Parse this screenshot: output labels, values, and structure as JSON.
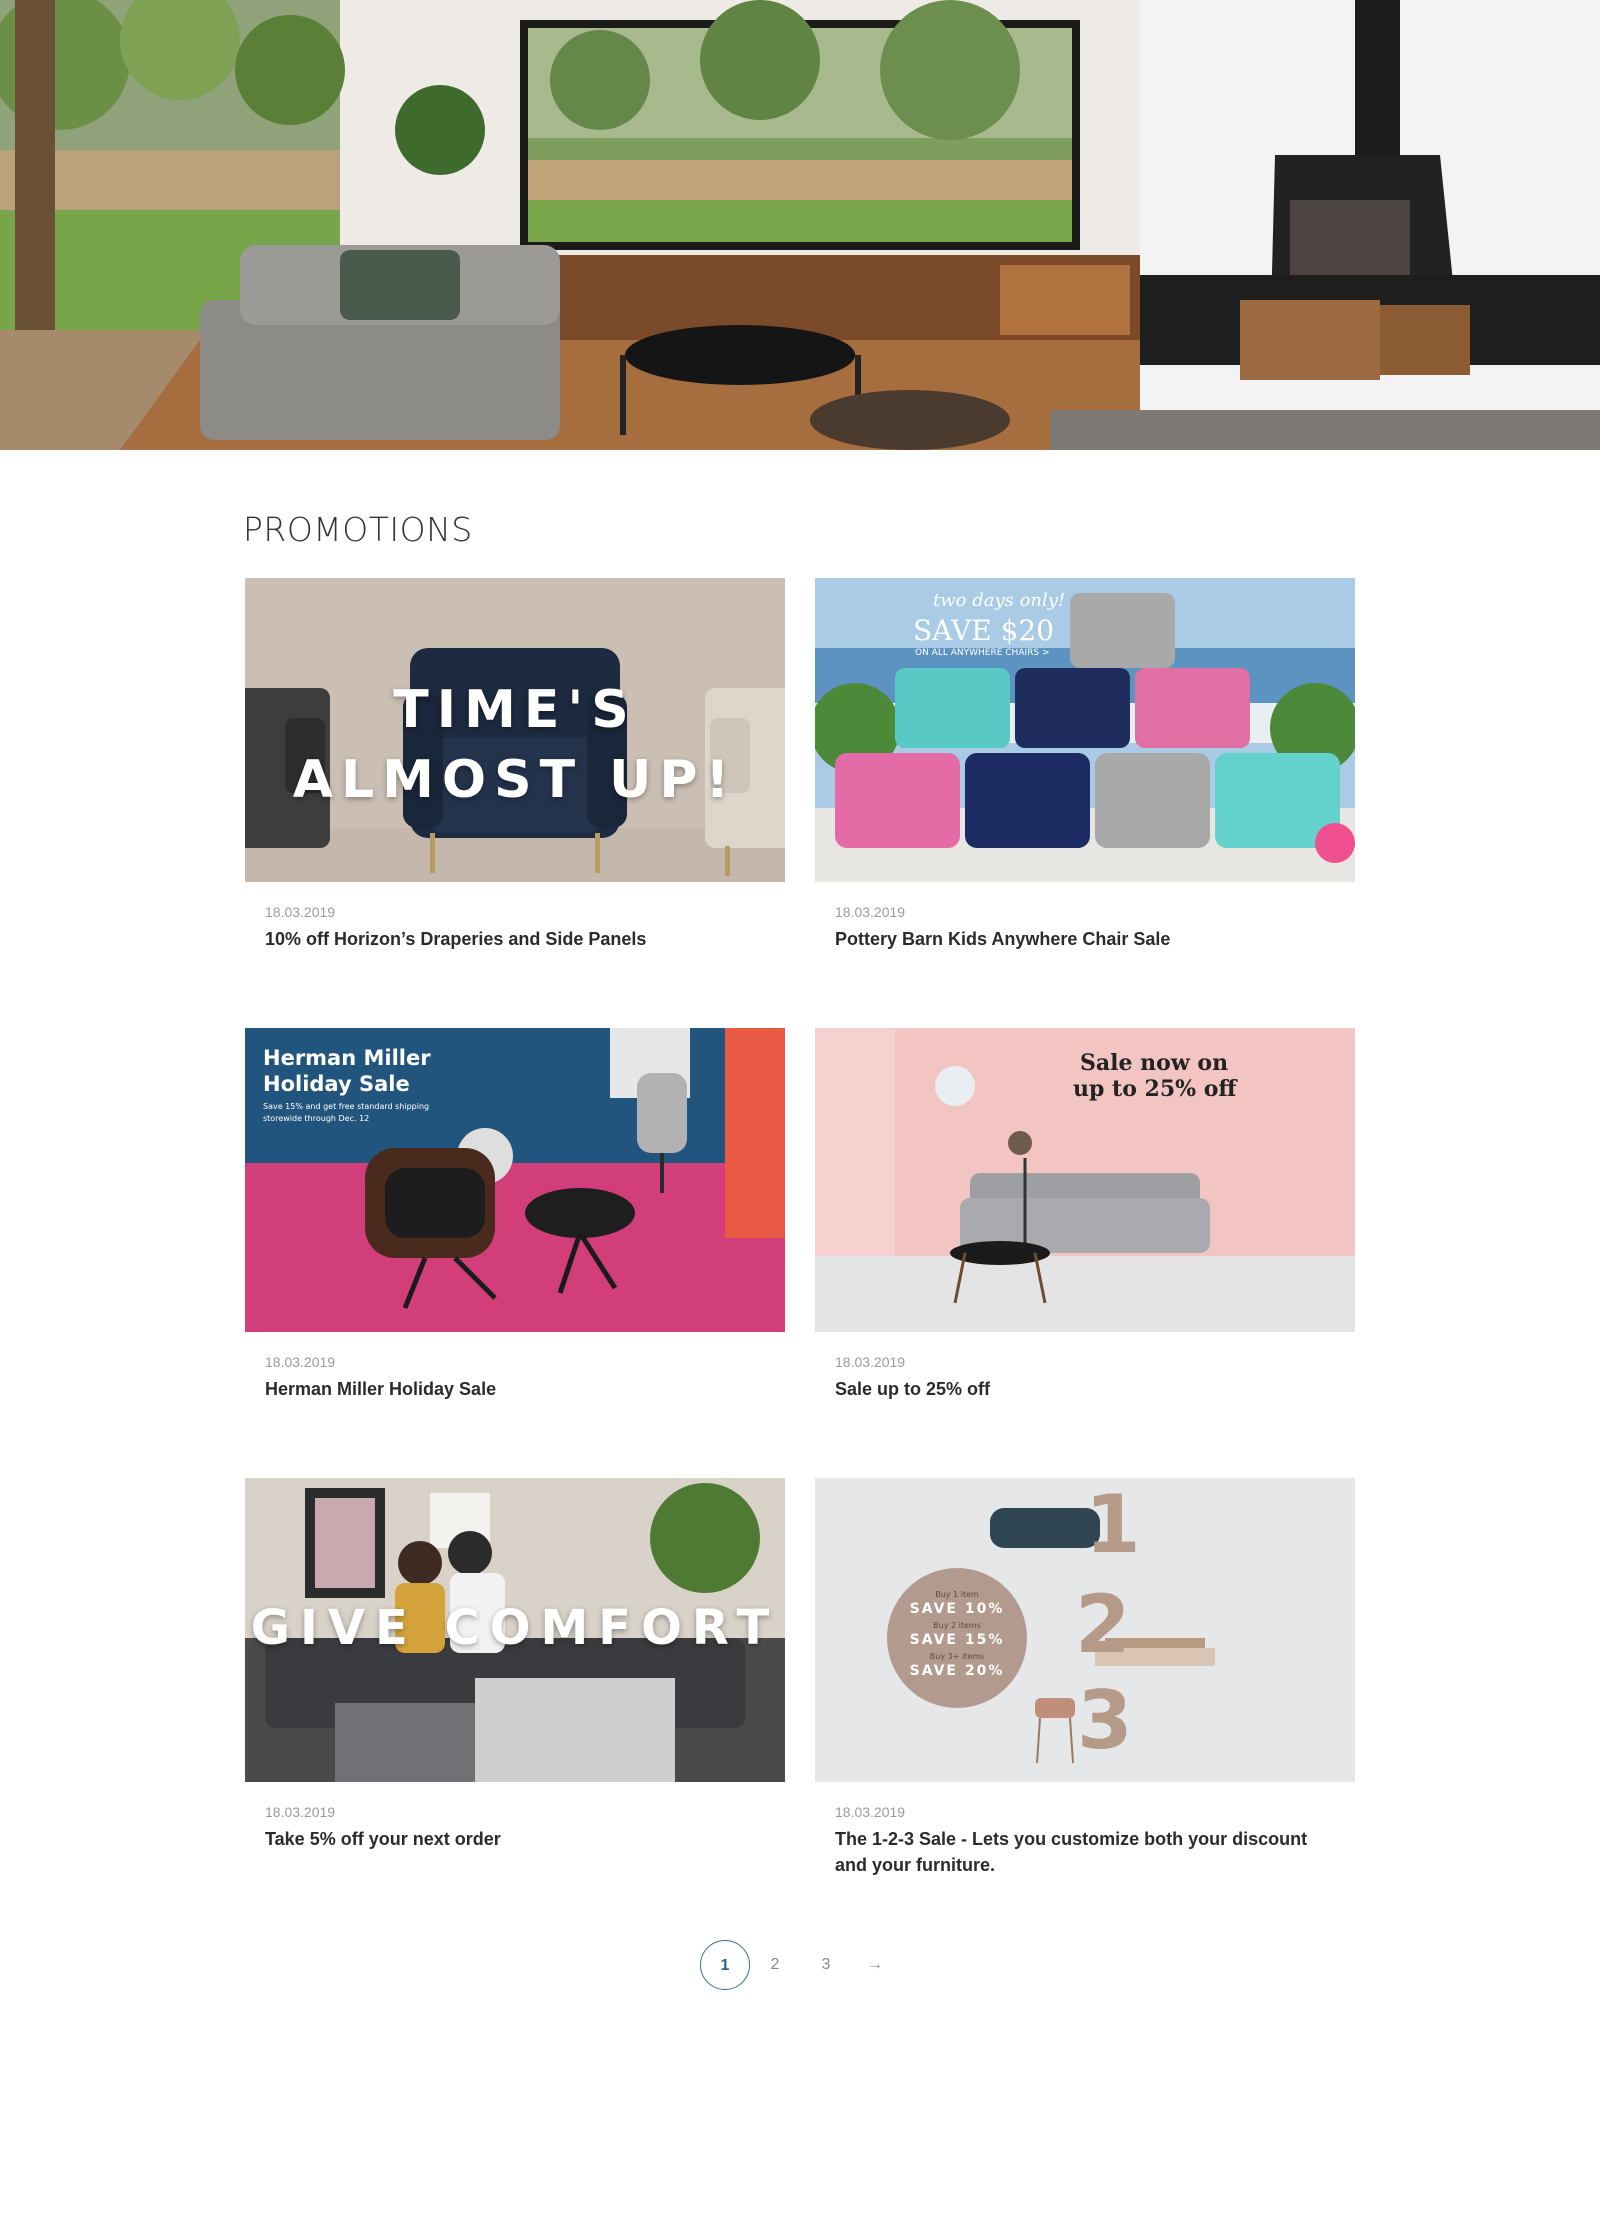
{
  "section": {
    "title": "PROMOTIONS"
  },
  "promotions": [
    {
      "date": "18.03.2019",
      "title": "10% off Horizon’s Draperies and Side Panels",
      "overlay_line1": "TIME'S",
      "overlay_line2": "ALMOST UP!"
    },
    {
      "date": "18.03.2019",
      "title": "Pottery Barn Kids Anywhere Chair Sale",
      "overlay_line1": "two days only!",
      "overlay_line2": "SAVE $20",
      "overlay_line3": "ON ALL ANYWHERE CHAIRS >"
    },
    {
      "date": "18.03.2019",
      "title": "Herman Miller Holiday Sale",
      "overlay_line1": "Herman Miller",
      "overlay_line2": "Holiday Sale",
      "overlay_line3": "Save 15% and get free standard shipping",
      "overlay_line4": "storewide through Dec. 12"
    },
    {
      "date": "18.03.2019",
      "title": "Sale up to 25% off",
      "overlay_line1": "Sale now on",
      "overlay_line2": "up to 25% off"
    },
    {
      "date": "18.03.2019",
      "title": "Take 5% off your next order",
      "overlay_line1": "GIVE COMFORT"
    },
    {
      "date": "18.03.2019",
      "title": "The 1-2-3 Sale - Lets you customize both your discount and your furniture.",
      "tier1_caption": "Buy 1 item",
      "tier1_offer": "SAVE 10%",
      "tier2_caption": "Buy 2 items",
      "tier2_offer": "SAVE 15%",
      "tier3_caption": "Buy 3+ items",
      "tier3_offer": "SAVE 20%",
      "num1": "1",
      "num2": "2",
      "num3": "3"
    }
  ],
  "pagination": {
    "pages": [
      "1",
      "2",
      "3"
    ],
    "current": "1",
    "next_icon": "arrow-right-icon",
    "next_glyph": "→"
  },
  "colors": {
    "accent": "#3d6e9b",
    "title_text": "#2b2b2b",
    "date_text": "#9a9a9a"
  }
}
